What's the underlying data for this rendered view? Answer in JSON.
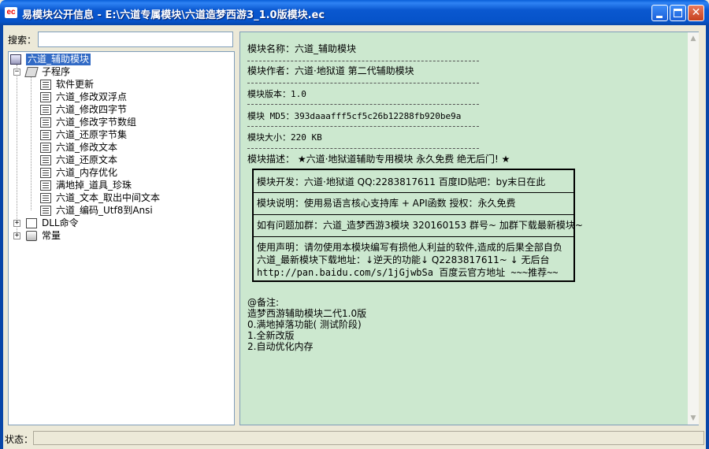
{
  "window": {
    "title": "易模块公开信息 - E:\\六道专属模块\\六道造梦西游3_1.0版模块.ec",
    "app_icon": "ec"
  },
  "search": {
    "label": "搜索：",
    "value": "",
    "placeholder": ""
  },
  "tree": {
    "root": "六道_辅助模块",
    "subprograms_label": "子程序",
    "items": [
      "软件更新",
      "六道_修改双浮点",
      "六道_修改四字节",
      "六道_修改字节数组",
      "六道_还原字节集",
      "六道_修改文本",
      "六道_还原文本",
      "六道_内存优化",
      "满地掉_道具_珍珠",
      "六道_文本_取出中间文本",
      "六道_编码_Utf8到Ansi"
    ],
    "dll_label": "DLL命令",
    "const_label": "常量"
  },
  "content": {
    "module_name": "模块名称：六道_辅助模块",
    "author": "模块作者：六道·地狱道 第二代辅助模块",
    "version": "模块版本：1.0",
    "md5": "模块 MD5：393daaafff5cf5c26b12288fb920be9a",
    "size": "模块大小：220 KB",
    "description": "模块描述： ★六道·地狱道辅助专用模块 永久免费 绝无后门! ★",
    "box_lines": [
      "模块开发：六道·地狱道 QQ:2283817611 百度ID贴吧：by末日在此",
      "模块说明：使用易语言核心支持库 + API函数   授权：永久免费",
      "如有问题加群：六道_造梦西游3模块 320160153 群号~ 加群下载最新模块~",
      "使用声明：请勿使用本模块编写有损他人利益的软件,造成的后果全部自负",
      "六道_最新模块下载地址：↓逆天的功能↓ Q2283817611~ ↓ 无后台",
      "http://pan.baidu.com/s/1jGjwbSa 百度云官方地址 ~~~推荐~~"
    ],
    "notes": [
      "@备注:",
      "造梦西游辅助模块二代1.0版",
      "0.满地掉落功能( 测试阶段)",
      "1.全新改版",
      "2.自动优化内存"
    ]
  },
  "status": {
    "label": "状态：",
    "value": ""
  }
}
